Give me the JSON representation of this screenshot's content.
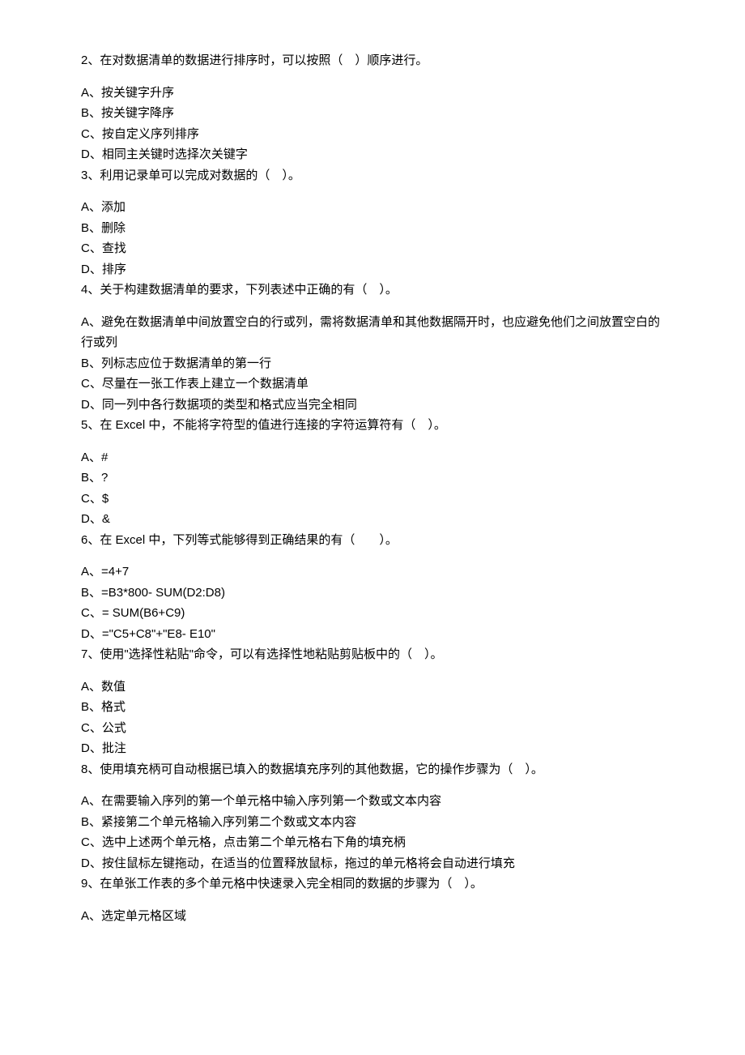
{
  "questions": [
    {
      "stem": "2、在对数据清单的数据进行排序时，可以按照（　）顺序进行。",
      "options": [
        "A、按关键字升序",
        "B、按关键字降序",
        "C、按自定义序列排序",
        "D、相同主关键时选择次关键字"
      ]
    },
    {
      "stem": "3、利用记录单可以完成对数据的（　）。",
      "options": [
        "A、添加",
        "B、删除",
        "C、查找",
        "D、排序"
      ]
    },
    {
      "stem": "4、关于构建数据清单的要求，下列表述中正确的有（　）。",
      "options": [
        "A、避免在数据清单中间放置空白的行或列，需将数据清单和其他数据隔开时，也应避免他们之间放置空白的行或列",
        "B、列标志应位于数据清单的第一行",
        "C、尽量在一张工作表上建立一个数据清单",
        "D、同一列中各行数据项的类型和格式应当完全相同"
      ]
    },
    {
      "stem": "5、在 Excel 中，不能将字符型的值进行连接的字符运算符有（　）。",
      "options": [
        "A、#",
        "B、?",
        "C、$",
        "D、&"
      ]
    },
    {
      "stem": "6、在 Excel 中，下列等式能够得到正确结果的有（　　）。",
      "options": [
        "A、=4+7",
        "B、=B3*800- SUM(D2:D8)",
        "C、= SUM(B6+C9)",
        "D、=\"C5+C8\"+\"E8- E10\""
      ]
    },
    {
      "stem": "7、使用\"选择性粘贴\"命令，可以有选择性地粘贴剪贴板中的（　）。",
      "options": [
        "A、数值",
        "B、格式",
        "C、公式",
        "D、批注"
      ]
    },
    {
      "stem": "8、使用填充柄可自动根据已填入的数据填充序列的其他数据，它的操作步骤为（　）。",
      "options": [
        "A、在需要输入序列的第一个单元格中输入序列第一个数或文本内容",
        "B、紧接第二个单元格输入序列第二个数或文本内容",
        "C、选中上述两个单元格，点击第二个单元格右下角的填充柄",
        "D、按住鼠标左键拖动，在适当的位置释放鼠标，拖过的单元格将会自动进行填充"
      ]
    },
    {
      "stem": "9、在单张工作表的多个单元格中快速录入完全相同的数据的步骤为（　）。",
      "options": [
        "A、选定单元格区域"
      ]
    }
  ]
}
